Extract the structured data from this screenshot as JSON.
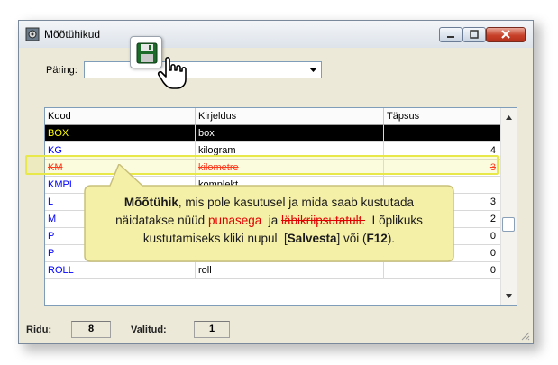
{
  "window": {
    "title": "Mõõtühikud",
    "icon": "gear-cube-icon"
  },
  "titlebar_buttons": [
    "minimize-icon",
    "maximize-icon",
    "close-icon"
  ],
  "query": {
    "label": "Päring:",
    "value": ""
  },
  "grid": {
    "columns": [
      "Kood",
      "Kirjeldus",
      "Täpsus"
    ],
    "rows": [
      {
        "code": "BOX",
        "desc": "box",
        "prec": "",
        "state": "selected"
      },
      {
        "code": "KG",
        "desc": "kilogram",
        "prec": "4",
        "state": "normal"
      },
      {
        "code": "KM",
        "desc": "kilometre",
        "prec": "3",
        "state": "deleted"
      },
      {
        "code": "KMPL",
        "desc": "komplekt",
        "prec": "",
        "state": "normal"
      },
      {
        "code": "L",
        "desc": "",
        "prec": "3",
        "state": "normal"
      },
      {
        "code": "M",
        "desc": "",
        "prec": "2",
        "state": "normal"
      },
      {
        "code": "P",
        "desc": "",
        "prec": "0",
        "state": "normal"
      },
      {
        "code": "P",
        "desc": "",
        "prec": "0",
        "state": "normal"
      },
      {
        "code": "ROLL",
        "desc": "roll",
        "prec": "0",
        "state": "normal"
      }
    ]
  },
  "callout": {
    "bold_term": "Mõõtühik",
    "line1_rest": ", mis pole kasutusel ja mida saab kustutada",
    "line2_pre": "näidatakse nüüd ",
    "red_word": "punasega",
    "line2_mid": "  ja ",
    "strike_word": "läbikriipsutatult.",
    "line2_post": "  Lõplikuks",
    "line3_pre": "kustutamiseks kliki nupul  [",
    "save_word": "Salvesta",
    "line3_mid": "] või (",
    "key_word": "F12",
    "line3_post": ")."
  },
  "status": {
    "rows_label": "Ridu:",
    "rows_value": "8",
    "selected_label": "Valitud:",
    "selected_value": "1"
  },
  "colors": {
    "code_blue": "#0000ff",
    "deleted_red": "#ff0000",
    "highlight": "#e8e84a",
    "callout_fill": "#f5f0a8"
  }
}
